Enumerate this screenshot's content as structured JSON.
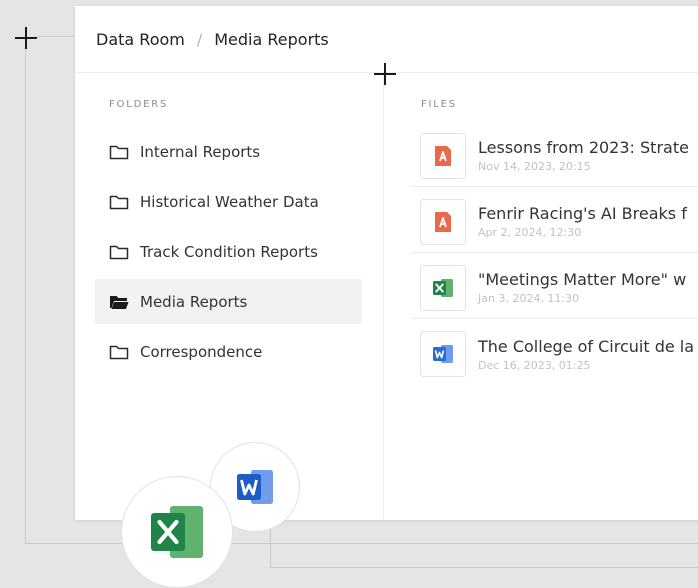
{
  "breadcrumb": {
    "root": "Data Room",
    "separator": "/",
    "current": "Media Reports"
  },
  "folders": {
    "label": "FOLDERS",
    "items": [
      {
        "label": "Internal Reports",
        "active": false
      },
      {
        "label": "Historical Weather Data",
        "active": false
      },
      {
        "label": "Track Condition Reports",
        "active": false
      },
      {
        "label": "Media Reports",
        "active": true
      },
      {
        "label": "Correspondence",
        "active": false
      }
    ]
  },
  "files": {
    "label": "FILES",
    "items": [
      {
        "name": "Lessons from 2023: Strate",
        "date": "Nov 14, 2023, 20:15",
        "type": "pdf-icon"
      },
      {
        "name": "Fenrir Racing's AI Breaks f",
        "date": "Apr 2, 2024, 12:30",
        "type": "pdf-icon"
      },
      {
        "name": "\"Meetings Matter More\" w",
        "date": "Jan 3, 2024, 11:30",
        "type": "excel-icon"
      },
      {
        "name": "The College of Circuit de la",
        "date": "Dec 16, 2023, 01:25",
        "type": "word-icon"
      }
    ]
  },
  "colors": {
    "pdf": "#e8694e",
    "excel": "#1e8449",
    "excel_light": "#5fb36f",
    "word": "#2b6cd4",
    "word_light": "#6f9cec",
    "active_folder_bg": "#f2f2f2"
  }
}
